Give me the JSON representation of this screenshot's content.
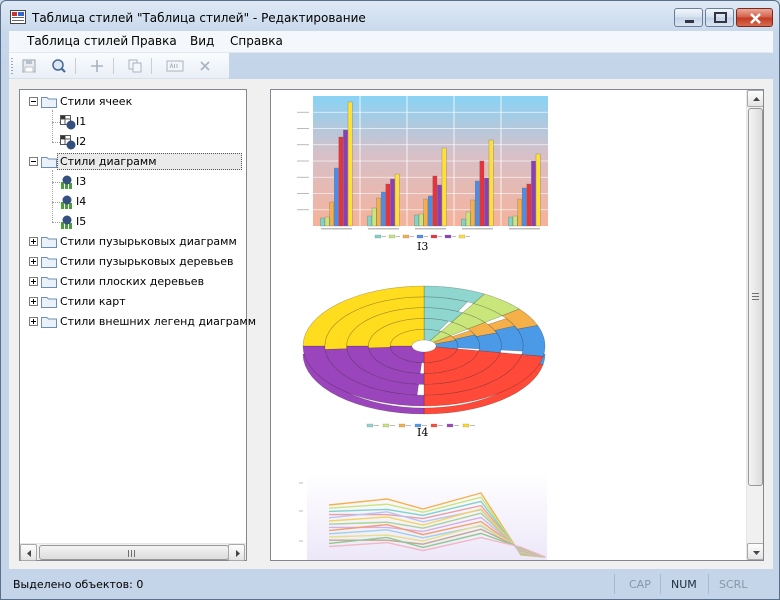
{
  "window": {
    "title": "Таблица стилей \"Таблица стилей\" - Редактирование",
    "accent": "#c4d5ea"
  },
  "menu": [
    "Таблица стилей",
    "Правка",
    "Вид",
    "Справка"
  ],
  "toolbar": {
    "icons": [
      "save-icon",
      "search-icon",
      "add-icon",
      "copy-icon",
      "rename-icon",
      "delete-icon"
    ]
  },
  "tree": {
    "groups": [
      {
        "label": "Стили ячеек",
        "expanded": true,
        "items": [
          "I1",
          "I2"
        ]
      },
      {
        "label": "Стили диаграмм",
        "expanded": true,
        "selected": true,
        "items": [
          "I3",
          "I4",
          "I5"
        ]
      },
      {
        "label": "Стили пузырьковых диаграмм",
        "expanded": false,
        "items": []
      },
      {
        "label": "Стили пузырьковых деревьев",
        "expanded": false,
        "items": []
      },
      {
        "label": "Стили плоских деревьев",
        "expanded": false,
        "items": []
      },
      {
        "label": "Стили карт",
        "expanded": false,
        "items": []
      },
      {
        "label": "Стили внешних легенд диаграмм",
        "expanded": false,
        "items": []
      }
    ]
  },
  "preview": {
    "captions": [
      "I3",
      "I4"
    ]
  },
  "chart_data": [
    {
      "type": "bar",
      "categories": [
        "1",
        "2",
        "3",
        "4",
        "5"
      ],
      "series": [
        {
          "color": "#7fd3c9",
          "values": [
            8,
            10,
            11,
            7,
            9
          ]
        },
        {
          "color": "#c8e67a",
          "values": [
            9,
            18,
            12,
            14,
            10
          ]
        },
        {
          "color": "#f6b04a",
          "values": [
            24,
            28,
            27,
            26,
            27
          ]
        },
        {
          "color": "#4b8de8",
          "values": [
            58,
            34,
            30,
            45,
            38
          ]
        },
        {
          "color": "#e8333a",
          "values": [
            89,
            42,
            50,
            65,
            42
          ]
        },
        {
          "color": "#8a3fb5",
          "values": [
            96,
            47,
            41,
            48,
            65
          ]
        },
        {
          "color": "#ffe135",
          "values": [
            124,
            52,
            78,
            86,
            72
          ]
        }
      ]
    },
    {
      "type": "pie",
      "rings": 5,
      "slices": [
        {
          "color": "#8fd6cf",
          "angle": [
            0,
            30
          ]
        },
        {
          "color": "#c8e67a",
          "angle": [
            30,
            52
          ]
        },
        {
          "color": "#f6b04a",
          "angle": [
            52,
            70
          ]
        },
        {
          "color": "#4b9ae8",
          "angle": [
            70,
            100
          ]
        },
        {
          "color": "#ff4a3a",
          "angle": [
            100,
            180
          ]
        },
        {
          "color": "#9b45bc",
          "angle": [
            180,
            270
          ]
        },
        {
          "color": "#ffdc1e",
          "angle": [
            270,
            360
          ]
        }
      ]
    },
    {
      "type": "line",
      "series_count": 14
    }
  ],
  "status": {
    "text": "Выделено объектов: 0",
    "indicators": [
      {
        "label": "CAP",
        "active": false
      },
      {
        "label": "NUM",
        "active": true
      },
      {
        "label": "SCRL",
        "active": false
      }
    ]
  }
}
